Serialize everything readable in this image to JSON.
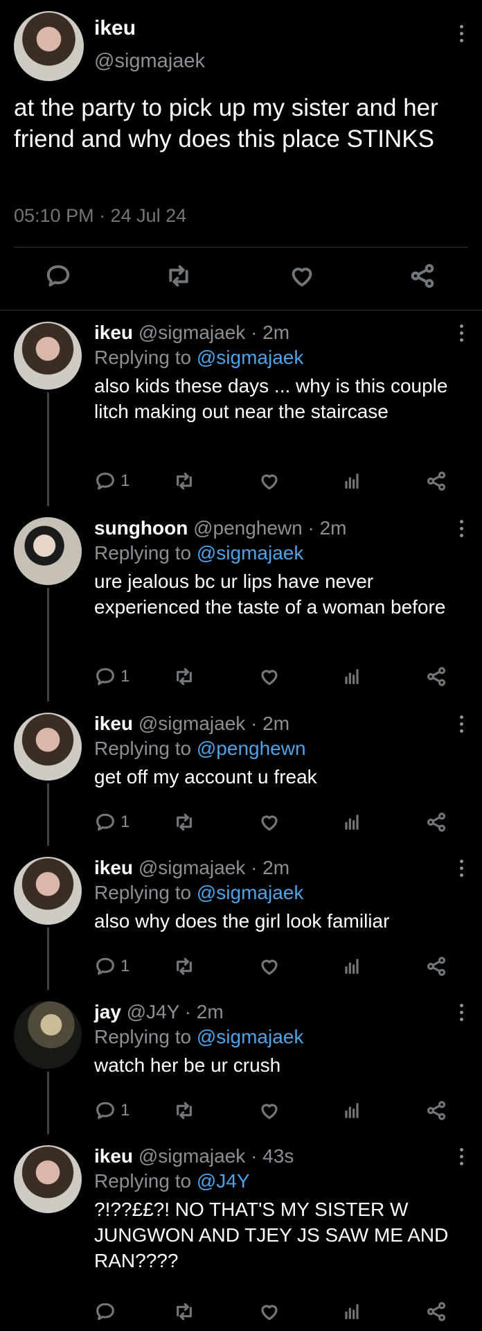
{
  "main": {
    "name": "ikeu",
    "handle": "@sigmajaek",
    "text": "at the party to pick up my sister and her friend and why does this place STINKS",
    "meta": "05:10 PM · 24 Jul 24"
  },
  "replies": [
    {
      "name": "ikeu",
      "handle": "@sigmajaek · 2m",
      "replying_prefix": "Replying to ",
      "replying_to": "@sigmajaek",
      "text": "also kids these days ... why is this couple litch making out near the staircase",
      "reply_count": "1"
    },
    {
      "name": "sunghoon",
      "handle": "@penghewn · 2m",
      "replying_prefix": "Replying to ",
      "replying_to": "@sigmajaek",
      "text": "ure jealous bc ur lips have never experienced the taste of a woman before",
      "reply_count": "1"
    },
    {
      "name": "ikeu",
      "handle": "@sigmajaek · 2m",
      "replying_prefix": "Replying to ",
      "replying_to": "@penghewn",
      "text": "get off my account u freak",
      "reply_count": "1"
    },
    {
      "name": "ikeu",
      "handle": "@sigmajaek · 2m",
      "replying_prefix": "Replying to ",
      "replying_to": "@sigmajaek",
      "text": "also why does the girl look familiar",
      "reply_count": "1"
    },
    {
      "name": "jay",
      "handle": "@J4Y · 2m",
      "replying_prefix": "Replying to ",
      "replying_to": "@sigmajaek",
      "text": "watch her be ur crush",
      "reply_count": "1"
    },
    {
      "name": "ikeu",
      "handle": "@sigmajaek · 43s",
      "replying_prefix": "Replying to ",
      "replying_to": "@J4Y",
      "text": "?!??££?! NO THAT'S MY SISTER W JUNGWON AND TJEY JS SAW ME AND RAN????",
      "reply_count": ""
    }
  ],
  "icons": [
    "reply-icon",
    "retweet-icon",
    "like-icon",
    "share-icon",
    "analytics-icon",
    "more-icon"
  ],
  "colors": {
    "background": "#000000",
    "text": "#ffffff",
    "secondary": "#8b9096",
    "mention": "#4fa3e8",
    "divider": "#2f3336"
  }
}
